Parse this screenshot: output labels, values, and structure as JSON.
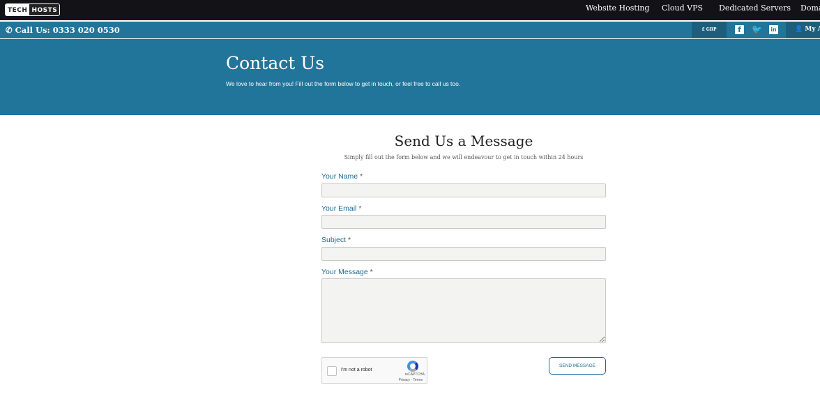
{
  "brand": {
    "logo_left": "TECH",
    "logo_right": "HOSTS"
  },
  "nav": [
    "Website Hosting",
    "Cloud VPS",
    "Dedicated Servers",
    "Domains"
  ],
  "subbar": {
    "call": "Call Us: 0333 020 0530",
    "currency": "£ GBP",
    "account": "My Account",
    "social": [
      "facebook-icon",
      "twitter-icon",
      "linkedin-icon"
    ]
  },
  "hero": {
    "title": "Contact Us",
    "text": "We love to hear from you! Fill out the form below to get in touch, or feel free to call us too."
  },
  "form": {
    "title": "Send Us a Message",
    "subtitle": "Simply fill out the form below and we will endeavour to get in touch within 24 hours",
    "name_label": "Your Name",
    "email_label": "Your Email",
    "subject_label": "Subject",
    "message_label": "Your Message",
    "required": "*",
    "captcha": {
      "label": "I'm not a robot",
      "brand": "reCAPTCHA",
      "links": "Privacy - Terms"
    },
    "send": "SEND MESSAGE"
  },
  "colors": {
    "topbar": "#131217",
    "brand_blue": "#21759a",
    "dark_blue": "#1d5e7c"
  }
}
